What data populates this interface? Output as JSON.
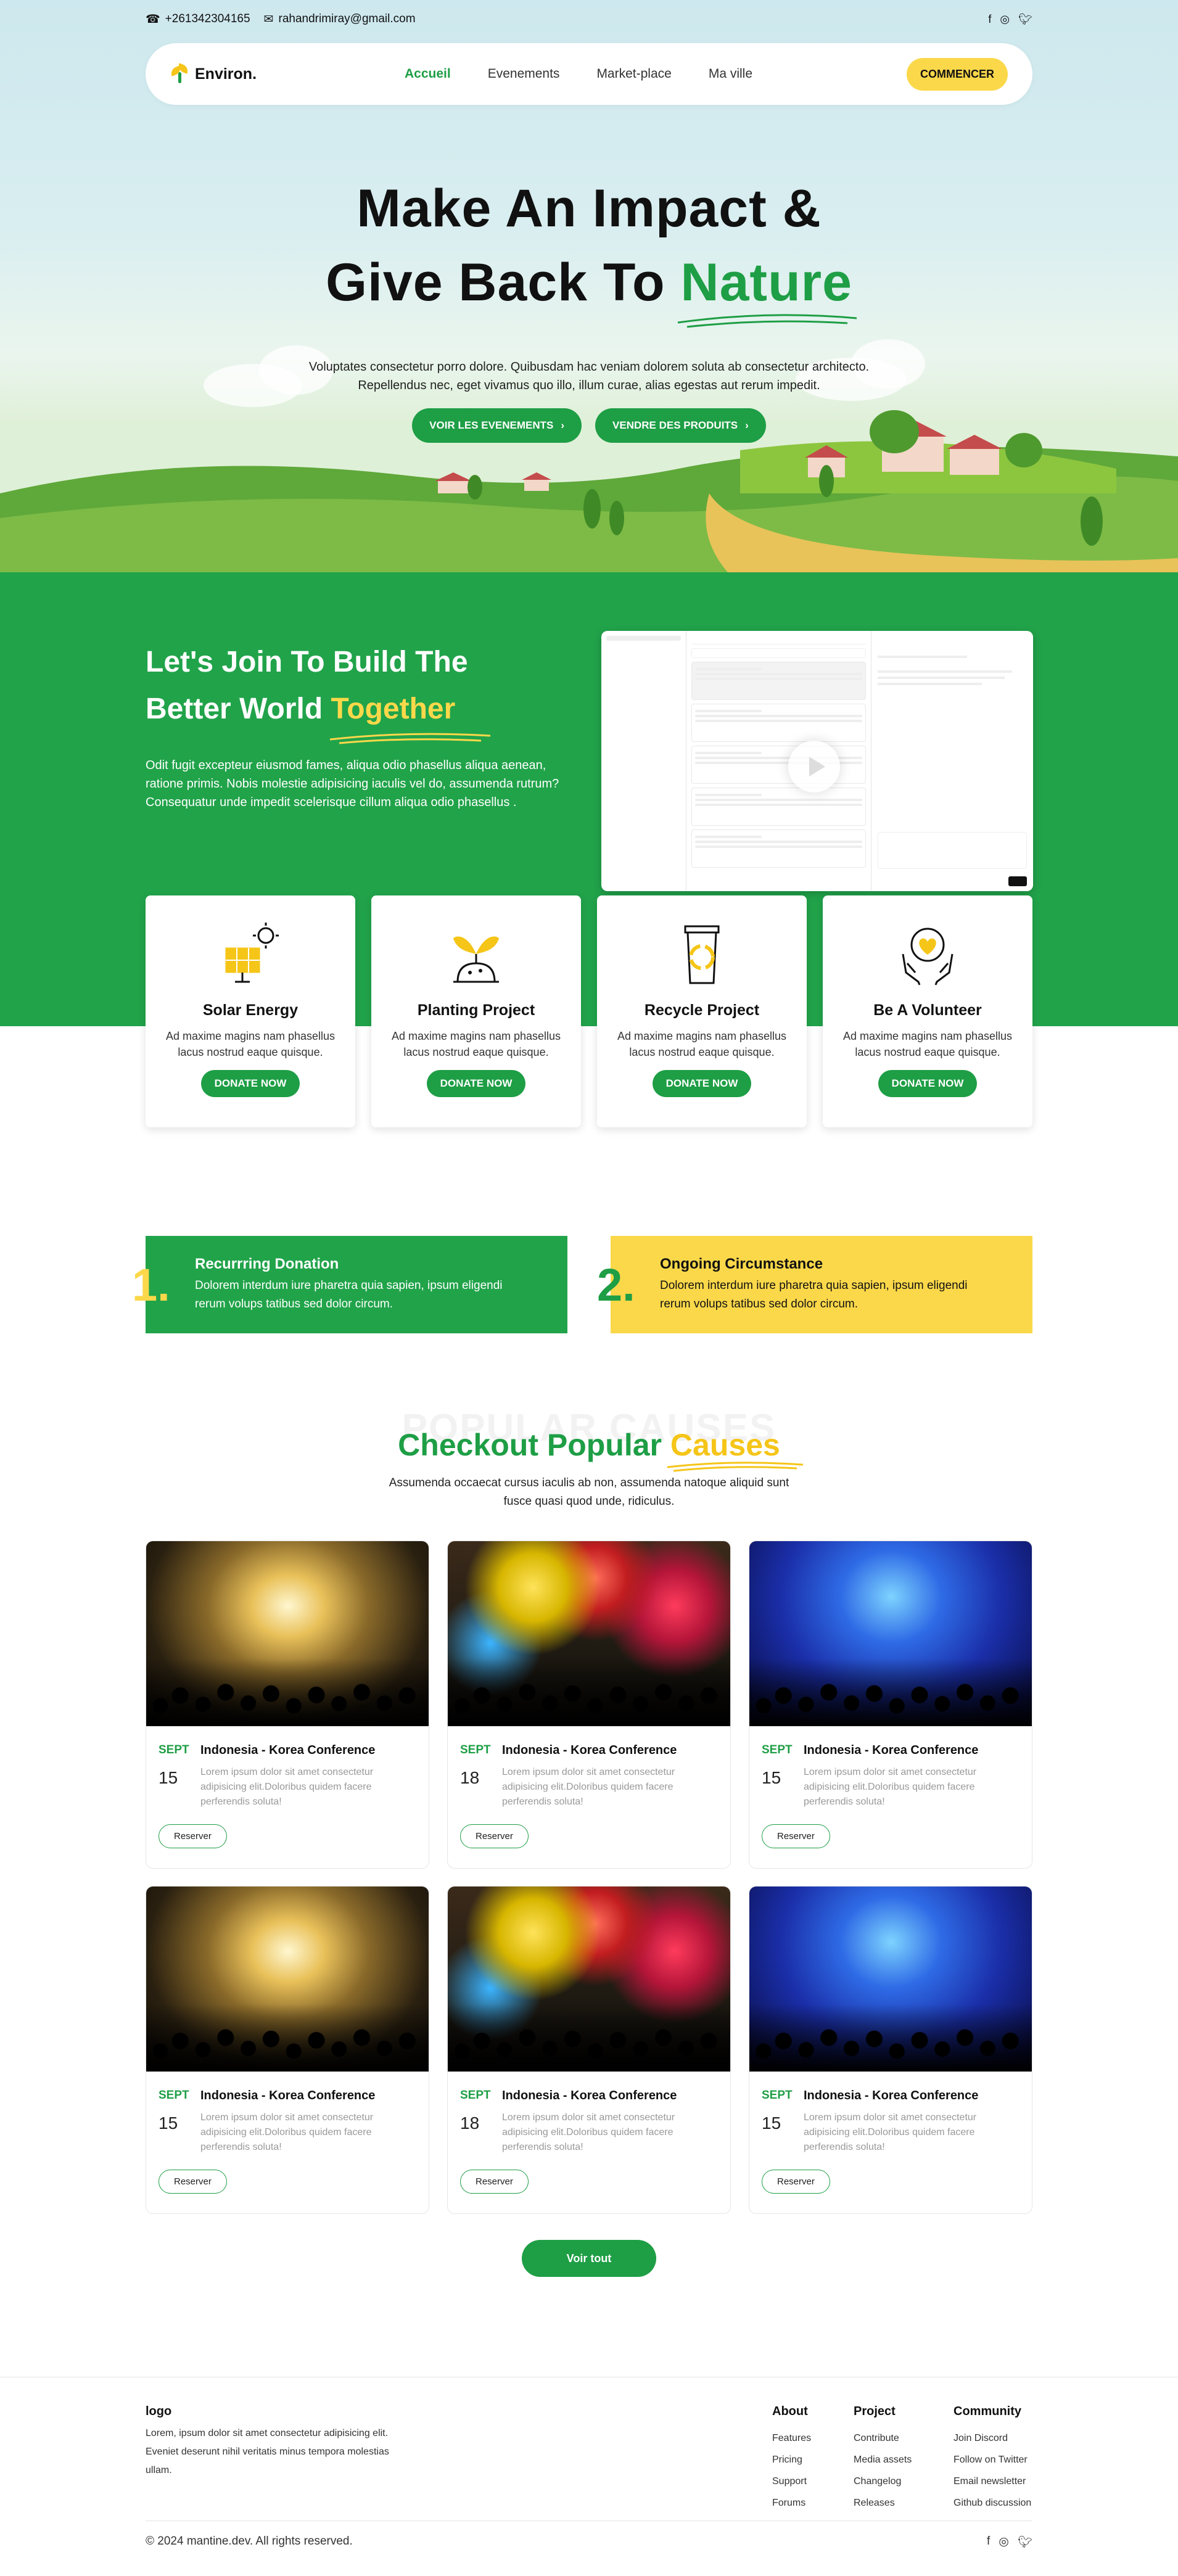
{
  "topbar": {
    "phone": "+261342304165",
    "email": "rahandrimiray@gmail.com",
    "socials": [
      "facebook-icon",
      "instagram-icon",
      "twitter-icon"
    ]
  },
  "nav": {
    "logo": "Environ.",
    "items": [
      "Accueil",
      "Evenements",
      "Market-place",
      "Ma ville"
    ],
    "active": "Accueil",
    "cta": "COMMENCER"
  },
  "hero": {
    "title_line1": "Make An Impact &",
    "title_line2_a": "Give Back To",
    "title_line2_b": "Nature",
    "desc_line1": "Voluptates consectetur porro dolore. Quibusdam hac veniam dolorem soluta ab consectetur architecto.",
    "desc_line2": "Repellendus nec, eget vivamus quo illo, illum curae, alias egestas aut rerum impedit.",
    "btn1": "VOIR LES EVENEMENTS",
    "btn2": "VENDRE DES PRODUITS"
  },
  "join": {
    "title_line1": "Let's Join To Build The",
    "title_line2_a": "Better World",
    "title_line2_b": "Together",
    "desc": "Odit fugit excepteur eiusmod fames, aliqua odio phasellus aliqua aenean, ratione primis. Nobis molestie adipisicing iaculis vel do, assumenda rutrum? Consequatur unde impedit scelerisque cillum aliqua odio phasellus ."
  },
  "cards": [
    {
      "title": "Solar Energy",
      "desc": "Ad maxime magins nam phasellus lacus nostrud eaque quisque.",
      "btn": "DONATE NOW",
      "icon": "solar-panel-icon"
    },
    {
      "title": "Planting Project",
      "desc": "Ad maxime magins nam phasellus lacus nostrud eaque quisque.",
      "btn": "DONATE NOW",
      "icon": "sprout-icon"
    },
    {
      "title": "Recycle Project",
      "desc": "Ad maxime magins nam phasellus lacus nostrud eaque quisque.",
      "btn": "DONATE NOW",
      "icon": "recycle-bin-icon"
    },
    {
      "title": "Be A Volunteer",
      "desc": "Ad maxime magins nam phasellus lacus nostrud eaque quisque.",
      "btn": "DONATE NOW",
      "icon": "heart-hands-icon"
    }
  ],
  "donations": [
    {
      "num": "1.",
      "title": "Recurrring Donation",
      "desc": "Dolorem interdum iure pharetra quia sapien, ipsum eligendi rerum volups tatibus sed dolor circum."
    },
    {
      "num": "2.",
      "title": "Ongoing Circumstance",
      "desc": "Dolorem interdum iure pharetra quia sapien, ipsum eligendi rerum volups tatibus sed dolor circum."
    }
  ],
  "causes": {
    "bg_word": "POPULAR CAUSES",
    "title_a": "Checkout Popular",
    "title_b": "Causes",
    "desc_line1": "Assumenda occaecat cursus iaculis ab non, assumenda natoque aliquid sunt",
    "desc_line2": "fusce quasi quod unde, ridiculus.",
    "events": [
      {
        "month": "SEPT",
        "day": "15",
        "title": "Indonesia - Korea Conference",
        "desc": "Lorem ipsum dolor sit amet consectetur adipisicing elit.Doloribus quidem facere perferendis soluta!",
        "btn": "Reserver"
      },
      {
        "month": "SEPT",
        "day": "18",
        "title": "Indonesia - Korea Conference",
        "desc": "Lorem ipsum dolor sit amet consectetur adipisicing elit.Doloribus quidem facere perferendis soluta!",
        "btn": "Reserver"
      },
      {
        "month": "SEPT",
        "day": "15",
        "title": "Indonesia - Korea Conference",
        "desc": "Lorem ipsum dolor sit amet consectetur adipisicing elit.Doloribus quidem facere perferendis soluta!",
        "btn": "Reserver"
      },
      {
        "month": "SEPT",
        "day": "15",
        "title": "Indonesia - Korea Conference",
        "desc": "Lorem ipsum dolor sit amet consectetur adipisicing elit.Doloribus quidem facere perferendis soluta!",
        "btn": "Reserver"
      },
      {
        "month": "SEPT",
        "day": "18",
        "title": "Indonesia - Korea Conference",
        "desc": "Lorem ipsum dolor sit amet consectetur adipisicing elit.Doloribus quidem facere perferendis soluta!",
        "btn": "Reserver"
      },
      {
        "month": "SEPT",
        "day": "15",
        "title": "Indonesia - Korea Conference",
        "desc": "Lorem ipsum dolor sit amet consectetur adipisicing elit.Doloribus quidem facere perferendis soluta!",
        "btn": "Reserver"
      }
    ],
    "see_all": "Voir tout"
  },
  "footer": {
    "logo": "logo",
    "desc": "Lorem, ipsum dolor sit amet consectetur adipisicing elit. Eveniet deserunt nihil veritatis minus tempora molestias ullam.",
    "columns": [
      {
        "title": "About",
        "links": [
          "Features",
          "Pricing",
          "Support",
          "Forums"
        ]
      },
      {
        "title": "Project",
        "links": [
          "Contribute",
          "Media assets",
          "Changelog",
          "Releases"
        ]
      },
      {
        "title": "Community",
        "links": [
          "Join Discord",
          "Follow on Twitter",
          "Email newsletter",
          "Github discussion"
        ]
      }
    ],
    "copyright": "© 2024 mantine.dev. All rights reserved."
  },
  "colors": {
    "green": "#21a34a",
    "yellow": "#fbd84a",
    "dark": "#111111"
  }
}
